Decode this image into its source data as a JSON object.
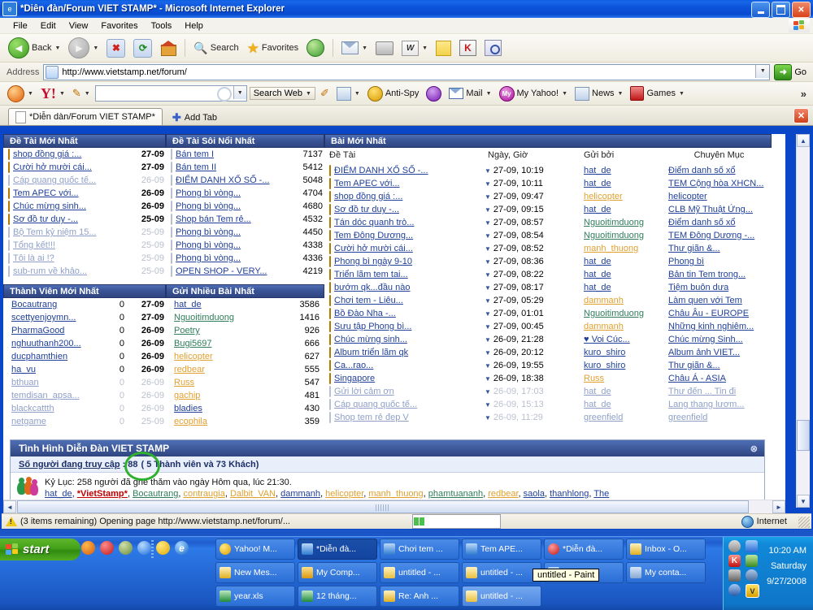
{
  "window": {
    "title": "*Diễn đàn/Forum VIET STAMP* - Microsoft Internet Explorer",
    "minimize": "_",
    "maximize": "□",
    "close": "✕"
  },
  "menu": [
    "File",
    "Edit",
    "View",
    "Favorites",
    "Tools",
    "Help"
  ],
  "toolbar": {
    "back": "Back",
    "search": "Search",
    "favorites": "Favorites",
    "w_label": "W"
  },
  "address": {
    "label": "Address",
    "url": "http://www.vietstamp.net/forum/",
    "go": "Go"
  },
  "yahoo_bar": {
    "logo": "Y!",
    "search_value": "",
    "search_web": "Search Web",
    "anti_spy": "Anti-Spy",
    "mail": "Mail",
    "my_yahoo": "My Yahoo!",
    "news": "News",
    "games": "Games",
    "overflow": "»"
  },
  "tabs": {
    "active_tab": "*Diễn dàn/Forum VIET STAMP*",
    "add_tab": "Add Tab",
    "close": "✕"
  },
  "forum": {
    "block_new_topics": {
      "header": "Đề Tài Mới Nhất",
      "rows": [
        {
          "title": "shop đồng giá :...",
          "date": "27-09",
          "new": true,
          "dim": false
        },
        {
          "title": "Cười hở mười cái...",
          "date": "27-09",
          "new": true,
          "dim": false
        },
        {
          "title": "Cáp quang quốc tế...",
          "date": "26-09",
          "new": false,
          "dim": true
        },
        {
          "title": "Tem APEC với...",
          "date": "26-09",
          "new": true,
          "dim": false
        },
        {
          "title": "Chúc mừng sinh...",
          "date": "26-09",
          "new": true,
          "dim": false
        },
        {
          "title": "Sơ đồ tư duy -...",
          "date": "25-09",
          "new": true,
          "dim": false
        },
        {
          "title": "Bộ Tem kỷ niệm 15...",
          "date": "25-09",
          "new": false,
          "dim": true
        },
        {
          "title": "Tổng kết!!!",
          "date": "25-09",
          "new": false,
          "dim": true
        },
        {
          "title": "Tôi là ai !?",
          "date": "25-09",
          "new": false,
          "dim": true
        },
        {
          "title": "sub-rum về khảo...",
          "date": "25-09",
          "new": false,
          "dim": true
        }
      ]
    },
    "block_hot_topics": {
      "header": "Đề Tài Sôi Nổi Nhất",
      "rows": [
        {
          "title": "Bán tem I",
          "count": "7137"
        },
        {
          "title": "Bán tem II",
          "count": "5412"
        },
        {
          "title": "ĐIỂM DANH XỔ SỐ -...",
          "count": "5048"
        },
        {
          "title": "Phong bì vòng...",
          "count": "4704"
        },
        {
          "title": "Phong bì vòng...",
          "count": "4680"
        },
        {
          "title": "Shop bán Tem rẻ...",
          "count": "4532"
        },
        {
          "title": "Phong bì vòng...",
          "count": "4450"
        },
        {
          "title": "Phong bì vòng...",
          "count": "4338"
        },
        {
          "title": "Phong bì vòng...",
          "count": "4336"
        },
        {
          "title": "OPEN SHOP - VERY...",
          "count": "4219"
        }
      ]
    },
    "block_new_posts": {
      "header": "Bài Mới Nhất",
      "columns": [
        "Đề Tài",
        "Ngày, Giờ",
        "Gửi bởi",
        "Chuyên Mục"
      ],
      "rows": [
        {
          "topic": "ĐIỂM DANH XỔ SỐ -...",
          "datetime": "27-09, 10:19",
          "author": "hat_de",
          "author_style": "normal",
          "forum": "Điểm danh số xổ",
          "new": true,
          "dim": false
        },
        {
          "topic": "Tem APEC với...",
          "datetime": "27-09, 10:11",
          "author": "hat_de",
          "author_style": "normal",
          "forum": "TEM Cộng hòa XHCN...",
          "new": true,
          "dim": false
        },
        {
          "topic": "shop đồng giá :...",
          "datetime": "27-09, 09:47",
          "author": "helicopter",
          "author_style": "orange",
          "forum": "helicopter",
          "new": true,
          "dim": false
        },
        {
          "topic": "Sơ đồ tư duy -...",
          "datetime": "27-09, 09:15",
          "author": "hat_de",
          "author_style": "normal",
          "forum": "CLB Mỹ Thuật Ứng...",
          "new": true,
          "dim": false
        },
        {
          "topic": "Tán dóc quanh trò...",
          "datetime": "27-09, 08:57",
          "author": "Nguoitimduong",
          "author_style": "mod",
          "forum": "Điểm danh số xổ",
          "new": true,
          "dim": false
        },
        {
          "topic": "Tem Đông Dương...",
          "datetime": "27-09, 08:54",
          "author": "Nguoitimduong",
          "author_style": "mod",
          "forum": "TEM Đông Dương -...",
          "new": true,
          "dim": false
        },
        {
          "topic": "Cười hở mười cái...",
          "datetime": "27-09, 08:52",
          "author": "manh_thuong",
          "author_style": "orange",
          "forum": "Thư giãn &...",
          "new": true,
          "dim": false
        },
        {
          "topic": "Phong bì ngày 9-10",
          "datetime": "27-09, 08:36",
          "author": "hat_de",
          "author_style": "normal",
          "forum": "Phong bì",
          "new": true,
          "dim": false
        },
        {
          "topic": "Triển lãm tem tai...",
          "datetime": "27-09, 08:22",
          "author": "hat_de",
          "author_style": "normal",
          "forum": "Bản tin Tem trong...",
          "new": true,
          "dim": false
        },
        {
          "topic": "bướm qk...đầu nào",
          "datetime": "27-09, 08:17",
          "author": "hat_de",
          "author_style": "normal",
          "forum": "Tiệm buôn dưa",
          "new": true,
          "dim": false
        },
        {
          "topic": "Chơi tem - Liêu...",
          "datetime": "27-09, 05:29",
          "author": "dammanh",
          "author_style": "orange",
          "forum": "Làm quen với Tem",
          "new": true,
          "dim": false
        },
        {
          "topic": "Bồ Đào Nha -...",
          "datetime": "27-09, 01:01",
          "author": "Nguoitimduong",
          "author_style": "mod",
          "forum": "Châu Âu - EUROPE",
          "new": true,
          "dim": false
        },
        {
          "topic": "Sưu tập Phong bì...",
          "datetime": "27-09, 00:45",
          "author": "dammanh",
          "author_style": "orange",
          "forum": "Những kinh nghiêm...",
          "new": true,
          "dim": false
        },
        {
          "topic": "Chúc mừng sinh...",
          "datetime": "26-09, 21:28",
          "author": "♥ Voi Cúc...",
          "author_style": "normal",
          "forum": "Chúc mừng Sinh...",
          "new": true,
          "dim": false
        },
        {
          "topic": "Album triển lãm qk",
          "datetime": "26-09, 20:12",
          "author": "kuro_shiro",
          "author_style": "normal",
          "forum": "Album ảnh VIET...",
          "new": true,
          "dim": false
        },
        {
          "topic": "Ca...rao...",
          "datetime": "26-09, 19:55",
          "author": "kuro_shiro",
          "author_style": "normal",
          "forum": "Thư giãn &...",
          "new": true,
          "dim": false
        },
        {
          "topic": "Singapore",
          "datetime": "26-09, 18:38",
          "author": "Russ",
          "author_style": "orange",
          "forum": "Châu Á - ASIA",
          "new": true,
          "dim": false
        },
        {
          "topic": "Gửi lời cảm ơn",
          "datetime": "26-09, 17:03",
          "author": "hat_de",
          "author_style": "normal",
          "forum": "Thư đến ... Tin đi",
          "new": false,
          "dim": true
        },
        {
          "topic": "Cáp quang quốc tế...",
          "datetime": "26-09, 15:13",
          "author": "hat_de",
          "author_style": "normal",
          "forum": "Lang thang lươm...",
          "new": false,
          "dim": true
        },
        {
          "topic": "Shop tem rẻ đep V",
          "datetime": "26-09, 11:29",
          "author": "greenfield",
          "author_style": "orange",
          "forum": "greenfield",
          "new": false,
          "dim": true
        }
      ]
    },
    "block_new_members": {
      "header": "Thành Viên Mới Nhất",
      "rows": [
        {
          "name": "Bocautrang",
          "posts": "0",
          "date": "27-09",
          "dim": false
        },
        {
          "name": "scettyenjoymn...",
          "posts": "0",
          "date": "27-09",
          "dim": false
        },
        {
          "name": "PharmaGood",
          "posts": "0",
          "date": "26-09",
          "dim": false
        },
        {
          "name": "nghuuthanh200...",
          "posts": "0",
          "date": "26-09",
          "dim": false
        },
        {
          "name": "ducphamthien",
          "posts": "0",
          "date": "26-09",
          "dim": false
        },
        {
          "name": "ha_vu",
          "posts": "0",
          "date": "26-09",
          "dim": false
        },
        {
          "name": "bthuan",
          "posts": "0",
          "date": "26-09",
          "dim": true
        },
        {
          "name": "temdisan_apsa...",
          "posts": "0",
          "date": "26-09",
          "dim": true
        },
        {
          "name": "blackcattth",
          "posts": "0",
          "date": "26-09",
          "dim": true
        },
        {
          "name": "netgame",
          "posts": "0",
          "date": "25-09",
          "dim": true
        }
      ]
    },
    "block_top_posters": {
      "header": "Gửi Nhiều Bài Nhất",
      "rows": [
        {
          "name": "hat_de",
          "count": "3586",
          "style": "normal"
        },
        {
          "name": "Nguoitimduong",
          "count": "1416",
          "style": "mod"
        },
        {
          "name": "Poetry",
          "count": "926",
          "style": "mod"
        },
        {
          "name": "Bugi5697",
          "count": "666",
          "style": "mod"
        },
        {
          "name": "helicopter",
          "count": "627",
          "style": "orange"
        },
        {
          "name": "redbear",
          "count": "555",
          "style": "orange"
        },
        {
          "name": "Russ",
          "count": "547",
          "style": "orange"
        },
        {
          "name": "gachip",
          "count": "481",
          "style": "orange"
        },
        {
          "name": "bladies",
          "count": "430",
          "style": "normal"
        },
        {
          "name": "ecophila",
          "count": "359",
          "style": "orange"
        }
      ]
    },
    "stats": {
      "header": "Tình Hình Diễn Đàn VIET STAMP",
      "online_label": "Số người đang truy cập",
      "online_value": "88",
      "online_detail": "( 5 Thành viên và 73 Khách)",
      "record_line": "Kỷ Lục: 258 người đã ghé thăm vào ngày Hôm qua, lúc 21:30.",
      "members_online": [
        {
          "name": "hat_de",
          "style": "normal"
        },
        {
          "name": "*VietStamp*",
          "style": "red"
        },
        {
          "name": "Bocautrang",
          "style": "mod"
        },
        {
          "name": "contraugia",
          "style": "orange"
        },
        {
          "name": "Dalbit_VAN",
          "style": "orange"
        },
        {
          "name": "dammanh",
          "style": "normal"
        },
        {
          "name": "helicopter",
          "style": "orange"
        },
        {
          "name": "manh_thuong",
          "style": "orange"
        },
        {
          "name": "phamtuananh",
          "style": "mod"
        },
        {
          "name": "redbear",
          "style": "orange"
        },
        {
          "name": "saola",
          "style": "normal"
        },
        {
          "name": "thanhlong",
          "style": "normal"
        },
        {
          "name": "The",
          "style": "normal"
        }
      ],
      "collapse": "⊗"
    }
  },
  "statusbar": {
    "text": "(3 items remaining) Opening page http://www.vietstamp.net/forum/...",
    "zone": "Internet"
  },
  "taskbar": {
    "start": "start",
    "tasks": [
      {
        "label": "Yahoo! M...",
        "icon": "ti-ym",
        "state": "normal"
      },
      {
        "label": "*Diễn đà...",
        "icon": "ti-ie",
        "state": "active"
      },
      {
        "label": "Chơi tem ...",
        "icon": "ti-ie",
        "state": "normal"
      },
      {
        "label": "Tem APE...",
        "icon": "ti-ie",
        "state": "normal"
      },
      {
        "label": "*Diễn đà...",
        "icon": "ti-op",
        "state": "normal"
      },
      {
        "label": "Inbox - O...",
        "icon": "ti-ol",
        "state": "normal"
      },
      {
        "label": "New Mes...",
        "icon": "ti-ol",
        "state": "normal"
      },
      {
        "label": "My Comp...",
        "icon": "ti-fo",
        "state": "normal"
      },
      {
        "label": "untitled - ...",
        "icon": "ti-pt",
        "state": "normal"
      },
      {
        "label": "untitled - ...",
        "icon": "ti-pt",
        "state": "normal"
      },
      {
        "label": "Tem ...",
        "icon": "ti-ie",
        "state": "normal"
      },
      {
        "label": "My conta...",
        "icon": "ti-ct",
        "state": "normal"
      },
      {
        "label": "year.xls",
        "icon": "ti-xl",
        "state": "normal"
      },
      {
        "label": "12 tháng...",
        "icon": "ti-xl",
        "state": "normal"
      },
      {
        "label": "Re: Anh ...",
        "icon": "ti-ol",
        "state": "normal"
      },
      {
        "label": "untitled - ...",
        "icon": "ti-pt",
        "state": "hot"
      }
    ],
    "tooltip": "untitled - Paint",
    "clock_time": "10:20 AM",
    "clock_day": "Saturday",
    "clock_date": "9/27/2008",
    "tray_v": "V"
  }
}
